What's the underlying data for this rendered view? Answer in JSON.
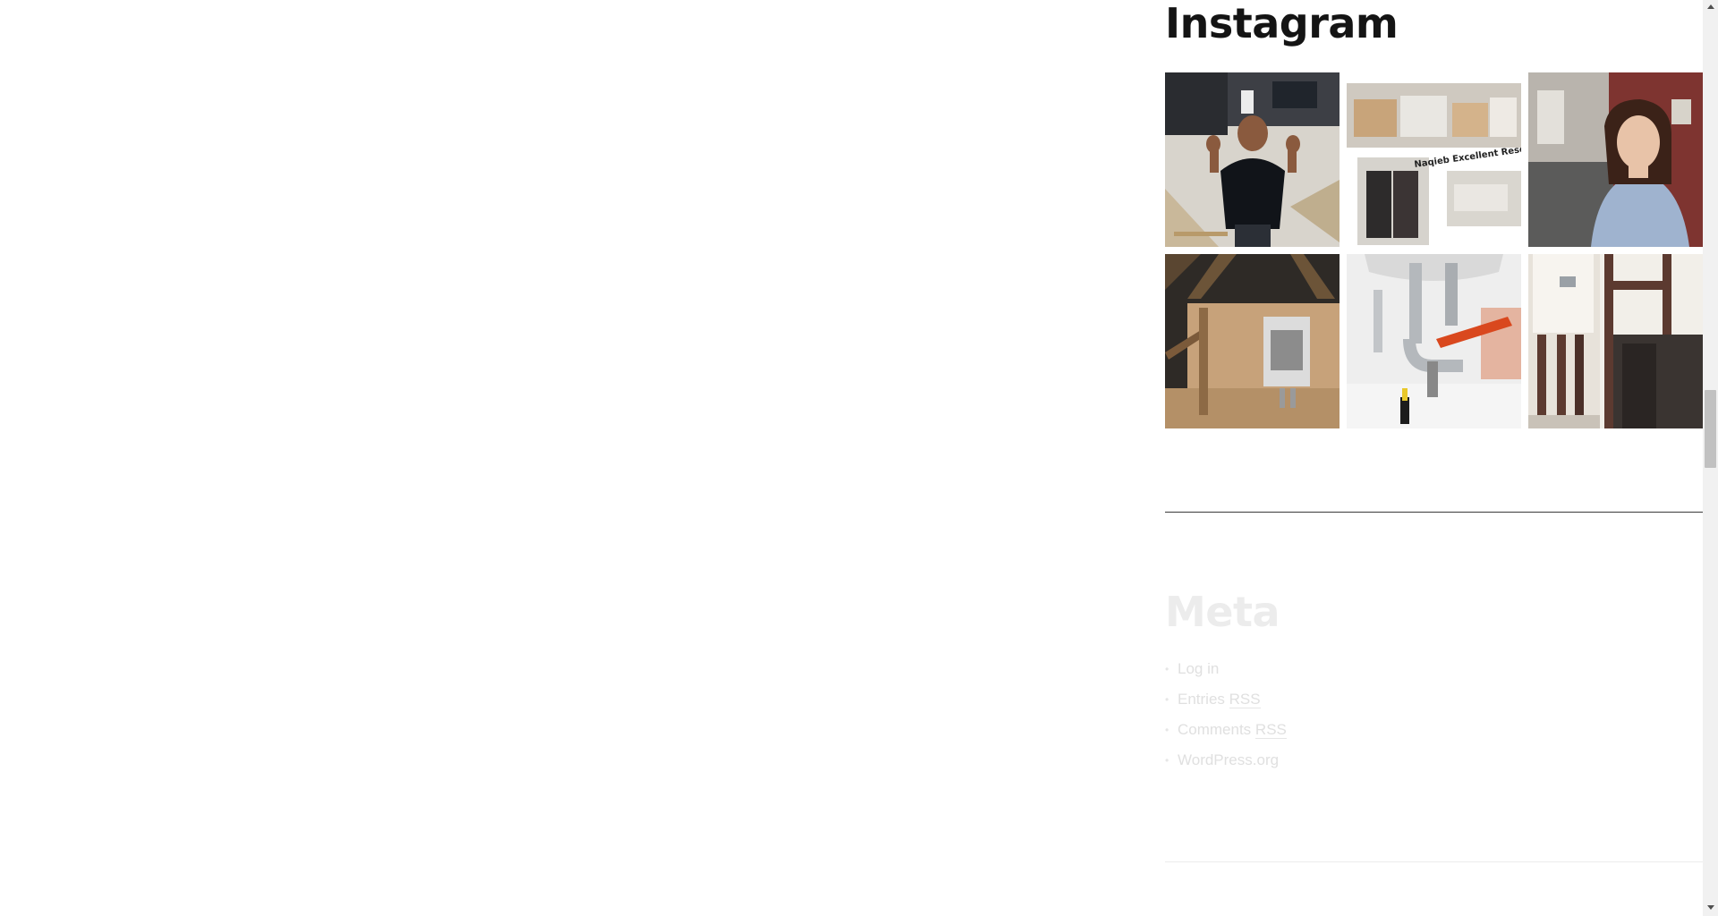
{
  "sidebar": {
    "instagram": {
      "title": "Instagram",
      "photos": [
        {
          "icon": "photo-plumber-thumbs-up"
        },
        {
          "icon": "photo-boxed-products-collage",
          "caption": "Naqieb Excellent Resources"
        },
        {
          "icon": "photo-customer-service-woman"
        },
        {
          "icon": "photo-attic-boiler-install"
        },
        {
          "icon": "photo-sink-pipe-wrench"
        },
        {
          "icon": "photo-boiler-pipes-wall"
        }
      ]
    },
    "meta": {
      "title": "Meta",
      "items": [
        {
          "label": "Log in"
        },
        {
          "label": "Entries",
          "abbr": "RSS"
        },
        {
          "label": "Comments",
          "abbr": "RSS"
        },
        {
          "label": "WordPress.org"
        }
      ]
    }
  },
  "colors": {
    "heading": "#141414",
    "faded_text": "#e2e2e2",
    "divider": "#3a3a3a",
    "scrollbar_track": "#f1f1f1",
    "scrollbar_thumb": "#c1c1c1"
  },
  "scrollbar": {
    "up_icon": "triangle-up-icon",
    "down_icon": "triangle-down-icon"
  }
}
